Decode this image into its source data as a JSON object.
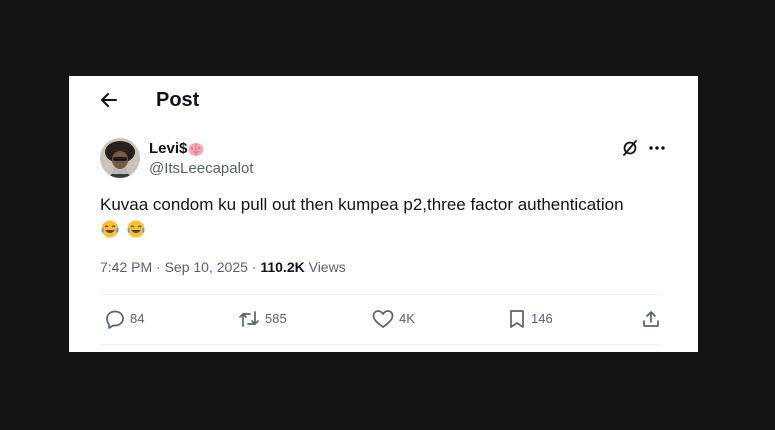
{
  "header": {
    "title": "Post",
    "back_icon": "arrow-left-icon"
  },
  "author": {
    "display_name": "Levi$",
    "name_emoji": "brain-emoji",
    "handle": "@ItsLeecapalot"
  },
  "post": {
    "text": "Kuvaa condom ku pull out then kumpea p2,three factor authentication",
    "emojis": [
      "tears-of-joy-emoji",
      "tears-of-joy-emoji"
    ],
    "time": "7:42 PM",
    "date": "Sep 10, 2025",
    "views_count": "110.2K",
    "views_label": "Views"
  },
  "actions": {
    "replies": "84",
    "reposts": "585",
    "likes": "4K",
    "bookmarks": "146"
  },
  "colors": {
    "text_primary": "#0f1419",
    "text_secondary": "#536471",
    "background_outer": "#141414",
    "card_background": "#ffffff"
  }
}
